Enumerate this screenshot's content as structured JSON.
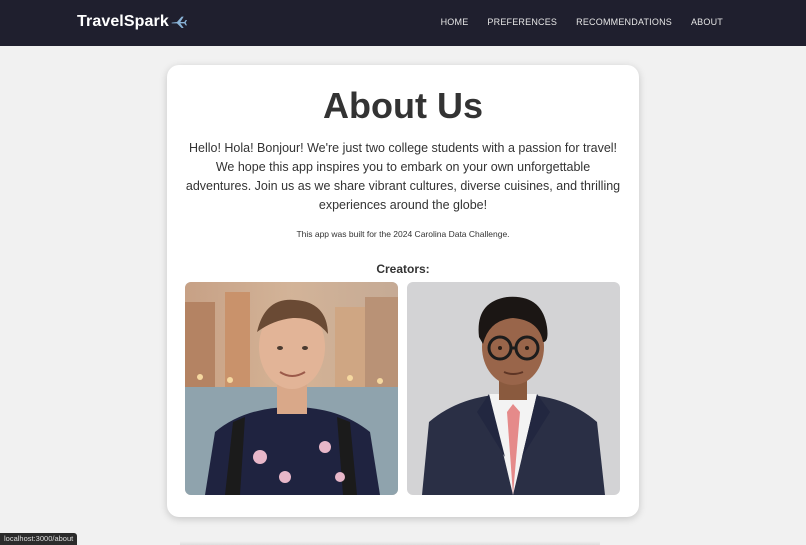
{
  "brand": {
    "name": "TravelSpark"
  },
  "nav": {
    "items": [
      {
        "label": "HOME"
      },
      {
        "label": "PREFERENCES"
      },
      {
        "label": "RECOMMENDATIONS"
      },
      {
        "label": "ABOUT"
      }
    ]
  },
  "about": {
    "title": "About Us",
    "intro": "Hello! Hola! Bonjour! We're just two college students with a passion for travel! We hope this app inspires you to embark on your own unforgettable adventures. Join us as we share vibrant cultures, diverse cuisines, and thrilling experiences around the globe!",
    "built_note": "This app was built for the 2024 Carolina Data Challenge.",
    "creators_label": "Creators:"
  },
  "status_bar": {
    "url": "localhost:3000/about"
  },
  "colors": {
    "navbar_bg": "#1f1f2e",
    "page_bg": "#f1f1f1",
    "card_bg": "#ffffff",
    "text": "#333333"
  }
}
